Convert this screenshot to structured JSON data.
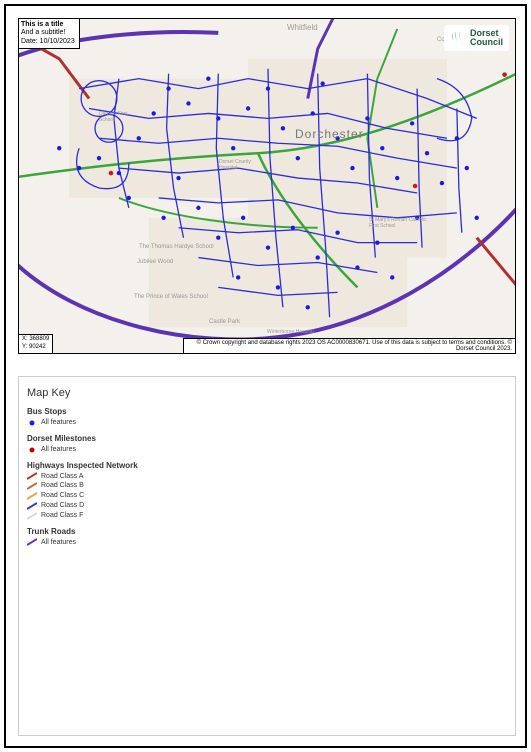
{
  "title_box": {
    "title": "This is a title",
    "subtitle": "And a subtitle!",
    "date_line": "Date: 10/10/2023"
  },
  "logo": {
    "text_top": "Dorset",
    "text_bottom": "Council"
  },
  "coords": {
    "x": "X: 368809",
    "y": "Y: 90242"
  },
  "copyright": "© Crown copyright and database rights 2023 OS AC0000830671. Use of this data is subject to terms and conditions. © Dorset Council 2023.",
  "map_labels": {
    "whitfield": "Whitfield",
    "dorchester": "Dorchester",
    "cokers": "Coker's Frome Farm",
    "thomas_hardye": "The Thomas Hardye School",
    "jubilee": "Jubilee Wood",
    "prince": "The Prince of Wales School",
    "castle": "Castle Park",
    "stmarys": "St Mary's Roman Catholic First School",
    "hospital": "Dorset County Hospital",
    "damers": "Damers First School",
    "wessex": "Winterborne Hospital"
  },
  "legend": {
    "title": "Map Key",
    "sections": [
      {
        "heading": "Bus Stops",
        "items": [
          {
            "label": "All features",
            "type": "dot",
            "color": "#1a1aff"
          }
        ]
      },
      {
        "heading": "Dorset Milestones",
        "items": [
          {
            "label": "All features",
            "type": "dot",
            "color": "#cc0000"
          }
        ]
      },
      {
        "heading": "Highways Inspected Network",
        "items": [
          {
            "label": "Road Class A",
            "type": "line",
            "color": "#cc2b2b"
          },
          {
            "label": "Road Class B",
            "type": "line",
            "color": "#cc6b2b"
          },
          {
            "label": "Road Class C",
            "type": "line",
            "color": "#d9a84a"
          },
          {
            "label": "Road Class D",
            "type": "line",
            "color": "#3a3ad9"
          },
          {
            "label": "Road Class F",
            "type": "line",
            "color": "#d9d9e6"
          }
        ]
      },
      {
        "heading": "Trunk Roads",
        "items": [
          {
            "label": "All features",
            "type": "line",
            "color": "#6633cc"
          }
        ]
      }
    ]
  }
}
